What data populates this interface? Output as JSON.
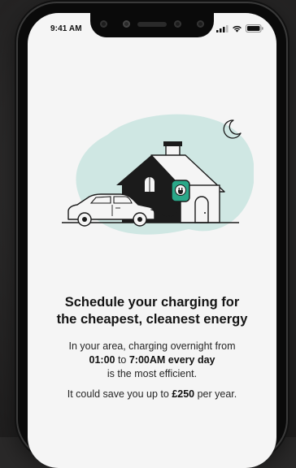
{
  "status_bar": {
    "time": "9:41 AM",
    "icons": [
      "cellular-signal-icon",
      "wifi-icon",
      "battery-icon"
    ]
  },
  "illustration": {
    "description_icons": [
      "moon-icon",
      "house-icon",
      "car-icon",
      "ev-charger-icon",
      "plug-icon"
    ],
    "colors": {
      "blob": "#cfe7e3",
      "house_roof": "#1b1b1b",
      "charger_accent": "#2aa889",
      "line": "#1b1b1b"
    }
  },
  "content": {
    "headline_line1": "Schedule your charging for",
    "headline_line2": "the cheapest, cleanest energy",
    "line1": "In your area, charging overnight from",
    "time_from": "01:00",
    "to_word": " to ",
    "time_to": "7:00AM",
    "every_day": " every day",
    "line3": "is the most efficient.",
    "save_prefix": "It could save you up to ",
    "save_amount": "£250",
    "save_suffix": " per year."
  }
}
